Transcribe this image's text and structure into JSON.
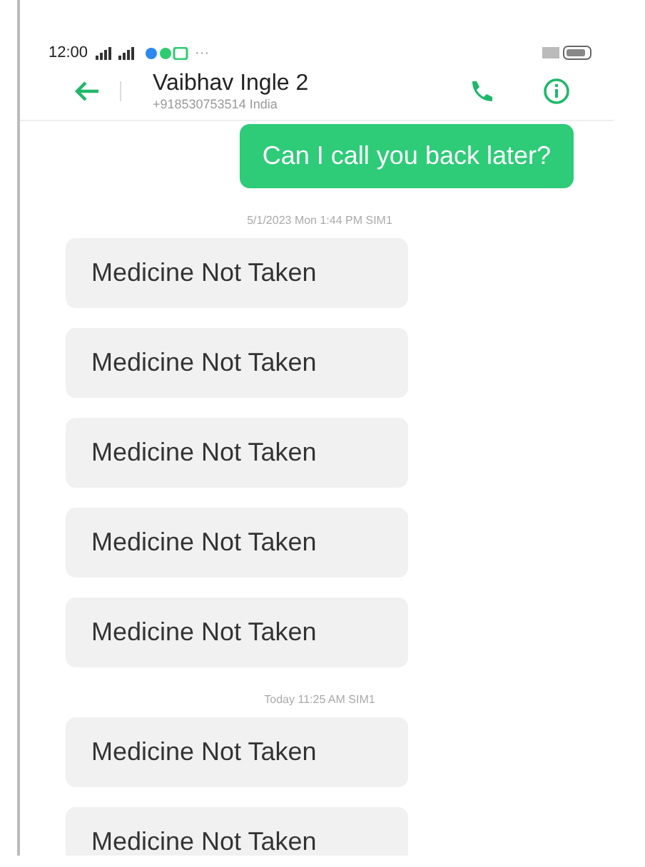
{
  "status_bar": {
    "time": "12:00",
    "more": "···"
  },
  "header": {
    "contact_name": "Vaibhav Ingle 2",
    "phone": "+918530753514  India"
  },
  "messages": [
    {
      "kind": "sent",
      "text": "Can I call you back later?"
    },
    {
      "kind": "timestamp",
      "text": "5/1/2023 Mon 1:44 PM  SIM1"
    },
    {
      "kind": "received",
      "text": "Medicine Not Taken"
    },
    {
      "kind": "received",
      "text": "Medicine Not Taken"
    },
    {
      "kind": "received",
      "text": "Medicine Not Taken"
    },
    {
      "kind": "received",
      "text": "Medicine Not Taken"
    },
    {
      "kind": "received",
      "text": "Medicine Not Taken"
    },
    {
      "kind": "timestamp",
      "text": "Today 11:25 AM  SIM1"
    },
    {
      "kind": "received",
      "text": "Medicine Not Taken"
    },
    {
      "kind": "received",
      "text": "Medicine Not Taken"
    }
  ]
}
